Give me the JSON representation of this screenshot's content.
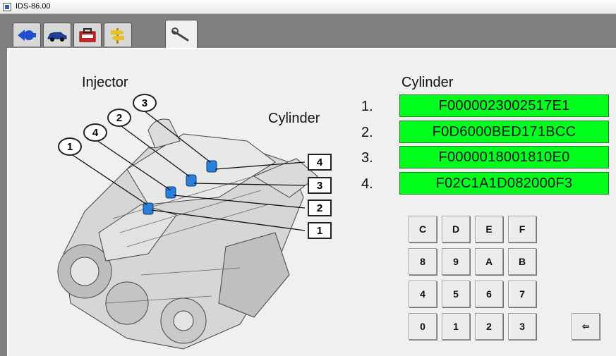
{
  "window": {
    "title": "IDS-86.00"
  },
  "tabs": [
    {
      "icon": "back-arrow-icon"
    },
    {
      "icon": "vehicle-icon"
    },
    {
      "icon": "toolbox-icon"
    },
    {
      "icon": "signpost-icon"
    },
    {
      "icon": "wrench-icon",
      "active": true
    }
  ],
  "diagram": {
    "injector_label": "Injector",
    "cylinder_label": "Cylinder",
    "injector_callouts": [
      "3",
      "2",
      "4",
      "1"
    ],
    "cylinder_boxes": [
      "4",
      "3",
      "2",
      "1"
    ]
  },
  "codes": {
    "header": "Cylinder",
    "rows": [
      {
        "num": "1.",
        "value": "F0000023002517E1"
      },
      {
        "num": "2.",
        "value": "F0D6000BED171BCC"
      },
      {
        "num": "3.",
        "value": "F0000018001810E0"
      },
      {
        "num": "4.",
        "value": "F02C1A1D082000F3"
      }
    ],
    "accent_color": "#00ff1c"
  },
  "keypad": {
    "rows": [
      [
        "C",
        "D",
        "E",
        "F"
      ],
      [
        "8",
        "9",
        "A",
        "B"
      ],
      [
        "4",
        "5",
        "6",
        "7"
      ],
      [
        "0",
        "1",
        "2",
        "3"
      ]
    ],
    "backspace": "⇦"
  }
}
